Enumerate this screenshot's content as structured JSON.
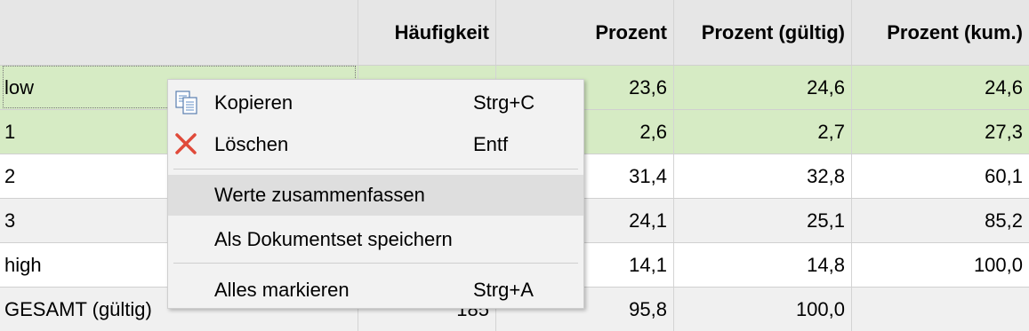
{
  "table": {
    "headers": [
      "",
      "Häufigkeit",
      "Prozent",
      "Prozent (gültig)",
      "Prozent (kum.)"
    ],
    "rows": [
      {
        "label": "low",
        "haeufigkeit": "",
        "prozent": "23,6",
        "gueltig": "24,6",
        "kum": "24,6"
      },
      {
        "label": "1",
        "haeufigkeit": "",
        "prozent": "2,6",
        "gueltig": "2,7",
        "kum": "27,3"
      },
      {
        "label": "2",
        "haeufigkeit": "",
        "prozent": "31,4",
        "gueltig": "32,8",
        "kum": "60,1"
      },
      {
        "label": "3",
        "haeufigkeit": "",
        "prozent": "24,1",
        "gueltig": "25,1",
        "kum": "85,2"
      },
      {
        "label": "high",
        "haeufigkeit": "",
        "prozent": "14,1",
        "gueltig": "14,8",
        "kum": "100,0"
      },
      {
        "label": "GESAMT (gültig)",
        "haeufigkeit": "185",
        "prozent": "95,8",
        "gueltig": "100,0",
        "kum": ""
      }
    ]
  },
  "context_menu": {
    "items": [
      {
        "label": "Kopieren",
        "shortcut": "Strg+C",
        "icon": "copy-icon"
      },
      {
        "label": "Löschen",
        "shortcut": "Entf",
        "icon": "delete-x-icon"
      },
      {
        "label": "Werte zusammenfassen",
        "shortcut": ""
      },
      {
        "label": "Als Dokumentset speichern",
        "shortcut": ""
      },
      {
        "label": "Alles markieren",
        "shortcut": "Strg+A"
      }
    ]
  },
  "colors": {
    "selected_row": "#d6ebc4",
    "header_bg": "#e6e6e6",
    "delete_icon": "#e04a3a",
    "menu_highlight": "#dedede"
  }
}
